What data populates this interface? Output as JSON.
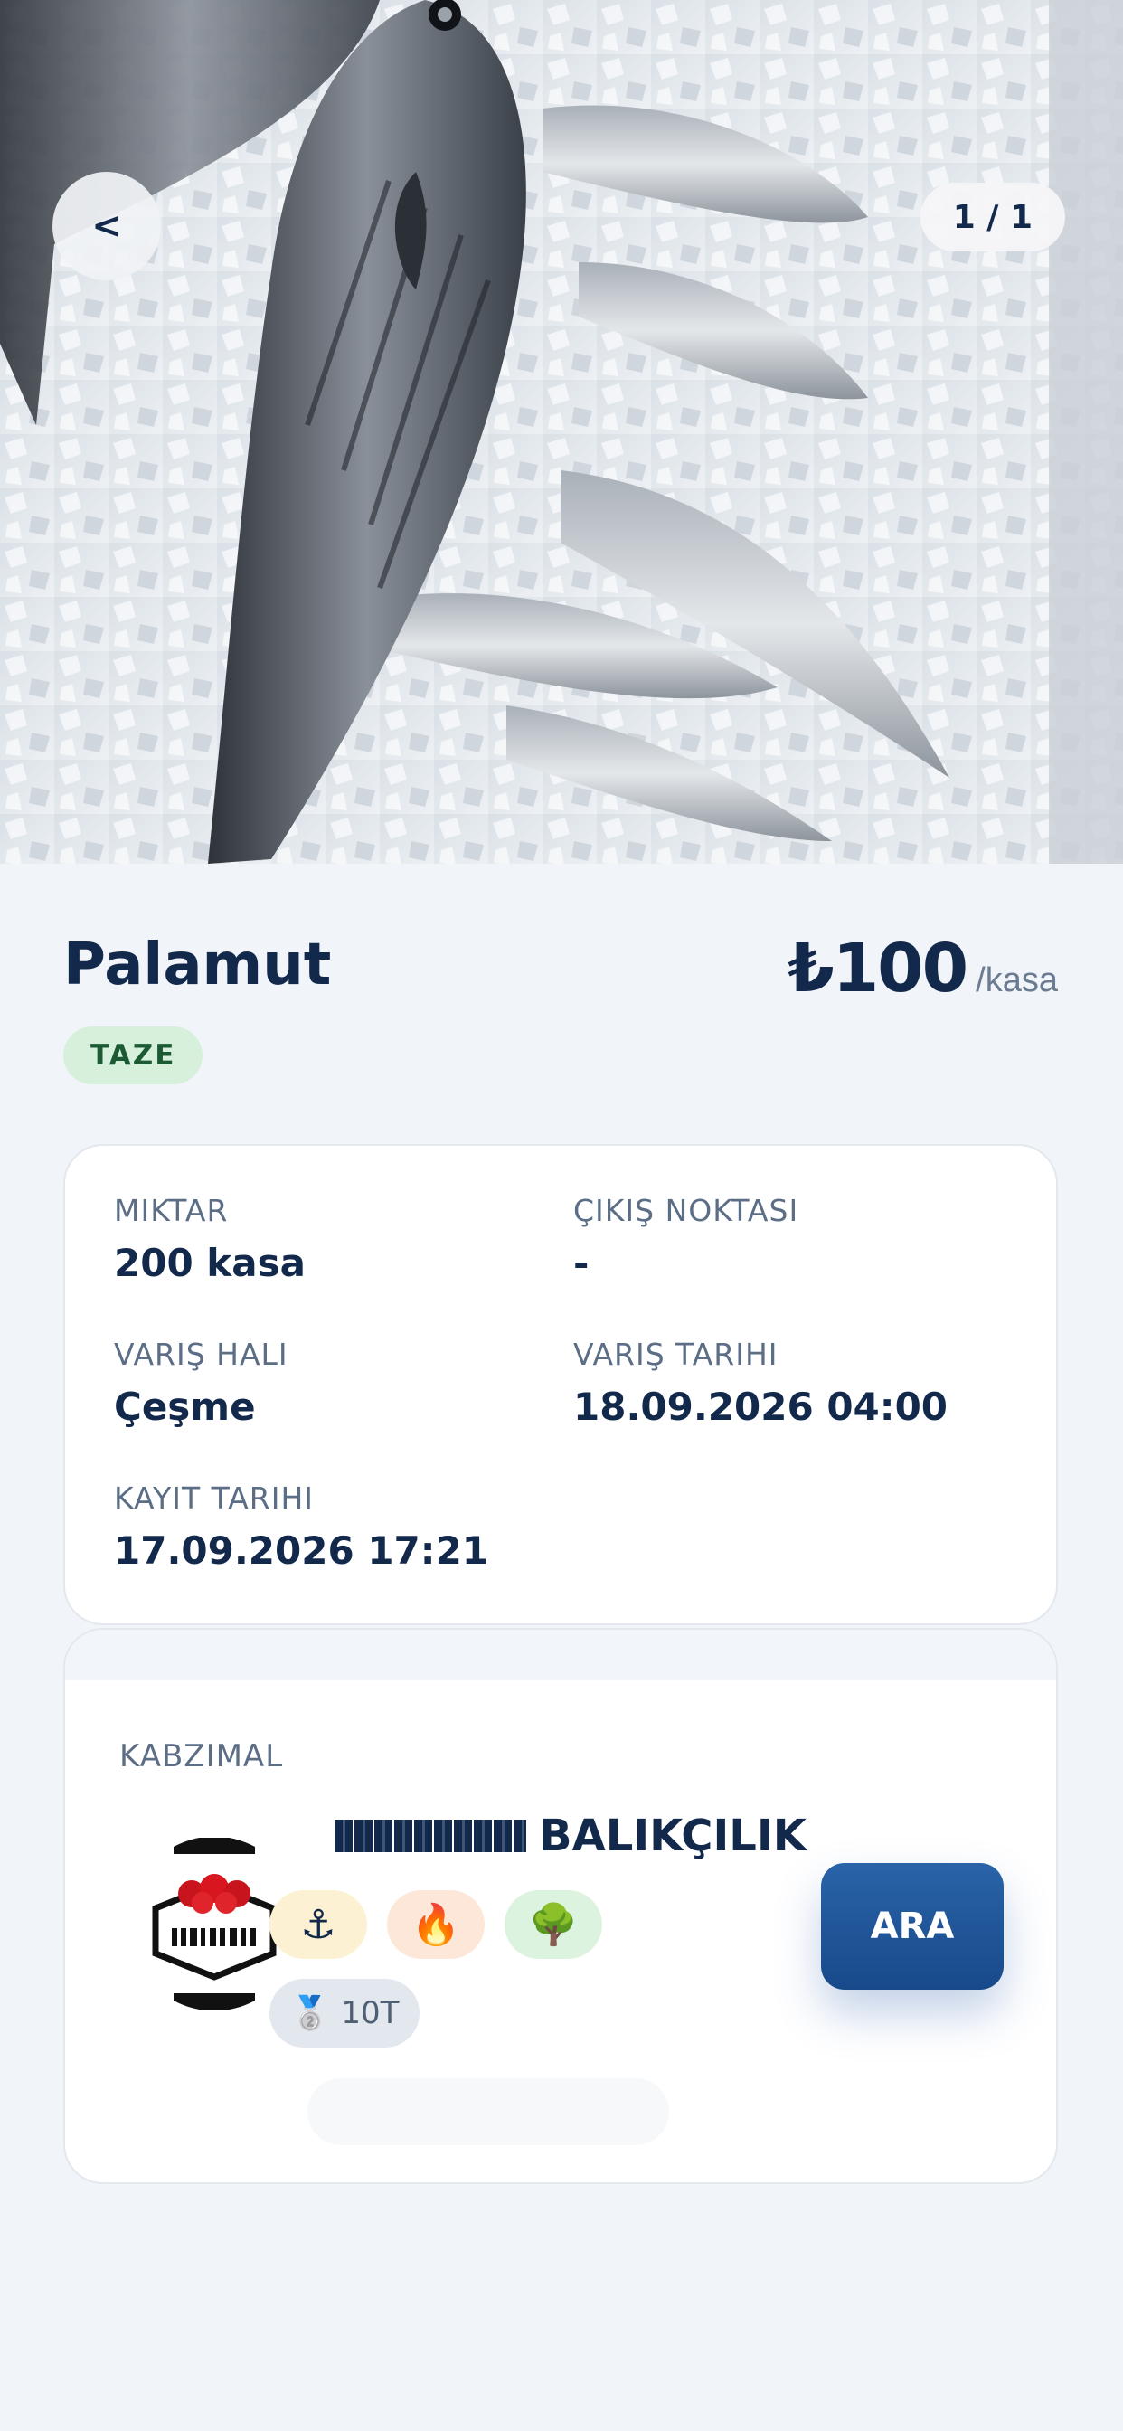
{
  "hero": {
    "counter": "1 / 1",
    "back_glyph": "<",
    "icons": {
      "back": "chevron-left-icon"
    }
  },
  "product": {
    "name": "Palamut",
    "price": "₺100",
    "price_unit": "/kasa",
    "badge": "TAZE"
  },
  "details": {
    "quantity_label": "MIKTAR",
    "quantity_value": "200 kasa",
    "origin_label": "ÇIKIŞ NOKTASI",
    "origin_value": "-",
    "arrival_market_label": "VARIŞ HALI",
    "arrival_market_value": "Çeşme",
    "arrival_date_label": "VARIŞ TARIHI",
    "arrival_date_value": "18.09.2026 04:00",
    "record_date_label": "KAYIT TARIHI",
    "record_date_value": "17.09.2026 17:21"
  },
  "dealer": {
    "section_label": "KABZIMAL",
    "name_suffix": "BALIKÇILIK",
    "badges": [
      "⚓",
      "🔥",
      "🌳"
    ],
    "level_medal": "🥈",
    "level_text": "10T",
    "call_label": "ARA"
  },
  "colors": {
    "primary": "#13294b",
    "call_button": "#1f5699",
    "fresh_badge_bg": "#d7f0dc",
    "page_bg": "#f1f4f8"
  }
}
